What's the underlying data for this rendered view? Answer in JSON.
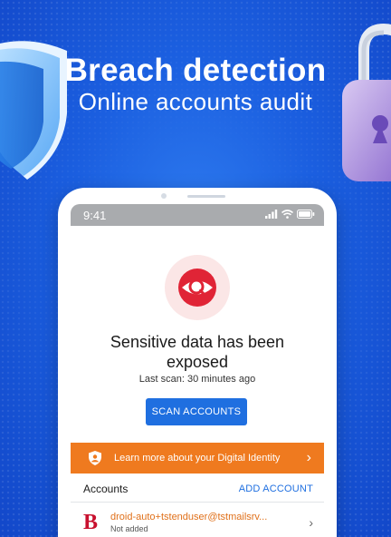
{
  "hero": {
    "title": "Breach detection",
    "subtitle": "Online accounts audit"
  },
  "phone": {
    "status_time": "9:41",
    "alert_icon": "eye-magnifier-icon",
    "heading": "Sensitive data has been exposed",
    "last_scan": "Last scan: 30 minutes ago",
    "scan_button": "SCAN ACCOUNTS",
    "banner": {
      "text": "Learn more about your Digital Identity",
      "icon": "identity-shield-icon",
      "color": "#ef7a1f"
    },
    "accounts": {
      "title": "Accounts",
      "add_label": "ADD ACCOUNT",
      "items": [
        {
          "email": "droid-auto+tstenduser@tstmailsrv...",
          "status": "Not added",
          "logo": "B"
        }
      ]
    }
  },
  "colors": {
    "background": "#1b5fe0",
    "accent": "#1f6fe0",
    "alert": "#e02436",
    "banner": "#ef7a1f"
  }
}
